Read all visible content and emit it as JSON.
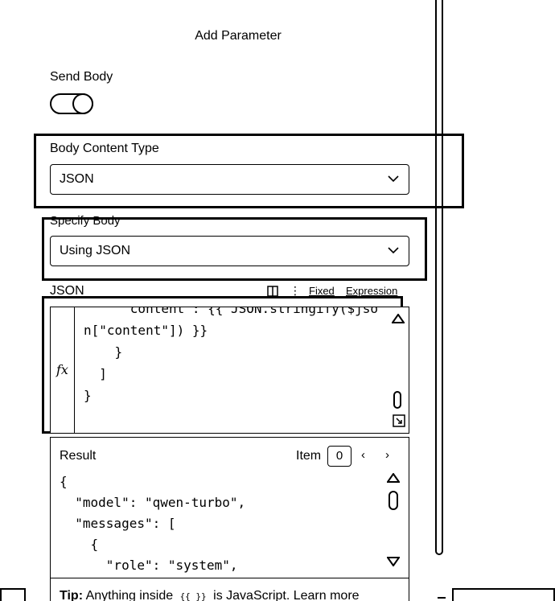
{
  "header": {
    "title": "Add Parameter"
  },
  "send_body": {
    "label": "Send Body",
    "enabled": true
  },
  "body_content_type": {
    "label": "Body Content Type",
    "value": "JSON"
  },
  "specify_body": {
    "label": "Specify Body",
    "value": "Using JSON"
  },
  "json_field": {
    "label": "JSON",
    "mode_fixed": "Fixed",
    "mode_expression": "Expression",
    "fx_label": "fx",
    "code_lines": [
      "      content : {{ JSON.stringify($jso",
      "n[\"content\"]) }}",
      "    }",
      "  ]",
      "}"
    ]
  },
  "result": {
    "label": "Result",
    "item_label": "Item",
    "item_index": "0",
    "code_lines": [
      "{",
      "  \"model\": \"qwen-turbo\",",
      "  \"messages\": [",
      "    {",
      "      \"role\": \"system\","
    ]
  },
  "tip": {
    "prefix": "Tip:",
    "text1": "Anything inside",
    "braces": "{{ }}",
    "text2": "is JavaScript.",
    "link": "Learn more"
  }
}
